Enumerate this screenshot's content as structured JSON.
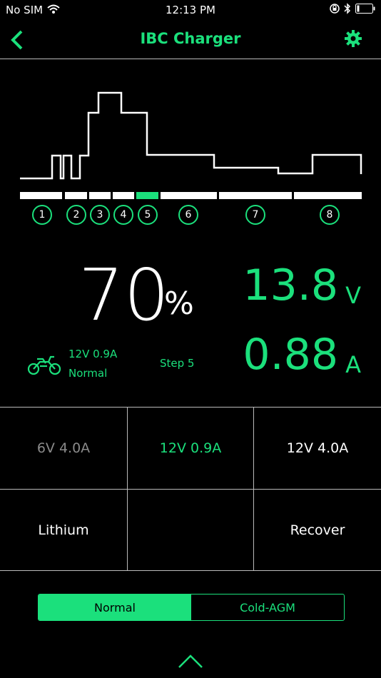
{
  "status_bar": {
    "carrier": "No SIM",
    "time": "12:13 PM"
  },
  "nav": {
    "title": "IBC Charger"
  },
  "steps": [
    "1",
    "2",
    "3",
    "4",
    "5",
    "6",
    "7",
    "8"
  ],
  "active_step_index": 4,
  "charge": {
    "percent": "70",
    "percent_sign": "%",
    "voltage": "13.8",
    "voltage_unit": "V",
    "current": "0.88",
    "current_unit": "A"
  },
  "mode_info": {
    "spec": "12V 0.9A",
    "mode": "Normal",
    "step": "Step 5"
  },
  "options": {
    "row1": [
      "6V 4.0A",
      "12V 0.9A",
      "12V 4.0A"
    ],
    "row2": [
      "Lithium",
      "",
      "Recover"
    ]
  },
  "toggle": {
    "left": "Normal",
    "right": "Cold-AGM"
  },
  "colors": {
    "accent": "#1be07c",
    "disabled": "#8a8a8a"
  },
  "icons": [
    "wifi-icon",
    "lock-rotation-icon",
    "bluetooth-icon",
    "battery-icon",
    "back-chevron-icon",
    "gear-icon",
    "motorcycle-icon",
    "chevron-up-icon"
  ]
}
